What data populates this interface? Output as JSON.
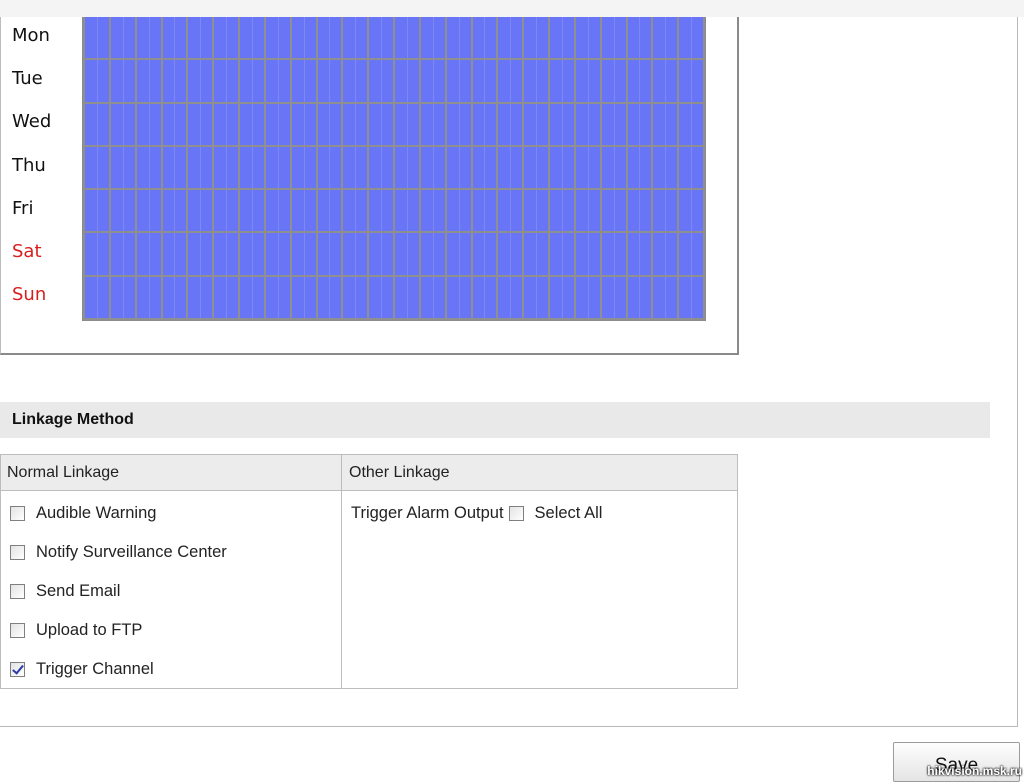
{
  "schedule": {
    "days": [
      {
        "label": "Mon",
        "weekend": false
      },
      {
        "label": "Tue",
        "weekend": false
      },
      {
        "label": "Wed",
        "weekend": false
      },
      {
        "label": "Thu",
        "weekend": false
      },
      {
        "label": "Fri",
        "weekend": false
      },
      {
        "label": "Sat",
        "weekend": true
      },
      {
        "label": "Sun",
        "weekend": true
      }
    ],
    "hours_per_day": 24,
    "cell_color": "#6875f7",
    "weekend_label_color": "#d81e1e"
  },
  "linkage": {
    "title": "Linkage Method",
    "normal": {
      "header": "Normal Linkage",
      "options": [
        {
          "label": "Audible Warning",
          "checked": false
        },
        {
          "label": "Notify Surveillance Center",
          "checked": false
        },
        {
          "label": "Send Email",
          "checked": false
        },
        {
          "label": "Upload to FTP",
          "checked": false
        },
        {
          "label": "Trigger Channel",
          "checked": true
        }
      ]
    },
    "other": {
      "header": "Other Linkage",
      "trigger_label": "Trigger Alarm Output",
      "select_all_label": "Select All",
      "select_all_checked": false
    }
  },
  "save_label": "Save",
  "watermark": "hikvision.msk.ru"
}
